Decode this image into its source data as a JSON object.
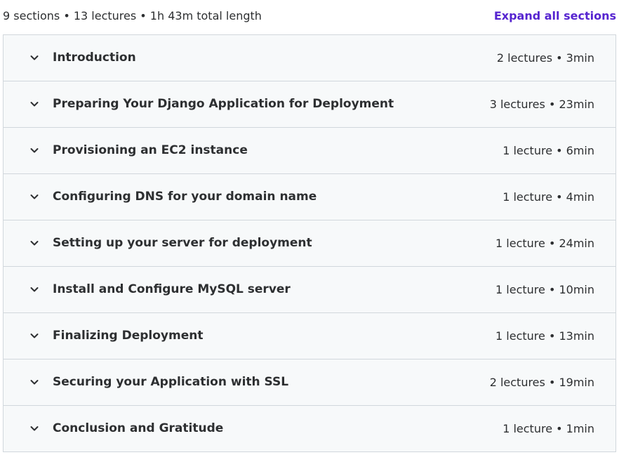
{
  "summary": {
    "text": "9 sections • 13 lectures • 1h 43m total length",
    "expand_label": "Expand all sections"
  },
  "colors": {
    "accent": "#5624d0",
    "row_background": "#f7f9fa",
    "border": "#d1d7dc",
    "text": "#2d2f31"
  },
  "sections": [
    {
      "title": "Introduction",
      "meta": "2 lectures • 3min",
      "icon": "chevron-down-icon"
    },
    {
      "title": "Preparing Your Django Application for Deployment",
      "meta": "3 lectures • 23min",
      "icon": "chevron-down-icon"
    },
    {
      "title": "Provisioning an EC2 instance",
      "meta": "1 lecture • 6min",
      "icon": "chevron-down-icon"
    },
    {
      "title": "Configuring DNS for your domain name",
      "meta": "1 lecture • 4min",
      "icon": "chevron-down-icon"
    },
    {
      "title": "Setting up your server for deployment",
      "meta": "1 lecture • 24min",
      "icon": "chevron-down-icon"
    },
    {
      "title": "Install and Configure MySQL server",
      "meta": "1 lecture • 10min",
      "icon": "chevron-down-icon"
    },
    {
      "title": "Finalizing Deployment",
      "meta": "1 lecture • 13min",
      "icon": "chevron-down-icon"
    },
    {
      "title": "Securing your Application with SSL",
      "meta": "2 lectures • 19min",
      "icon": "chevron-down-icon"
    },
    {
      "title": "Conclusion and Gratitude",
      "meta": "1 lecture • 1min",
      "icon": "chevron-down-icon"
    }
  ]
}
